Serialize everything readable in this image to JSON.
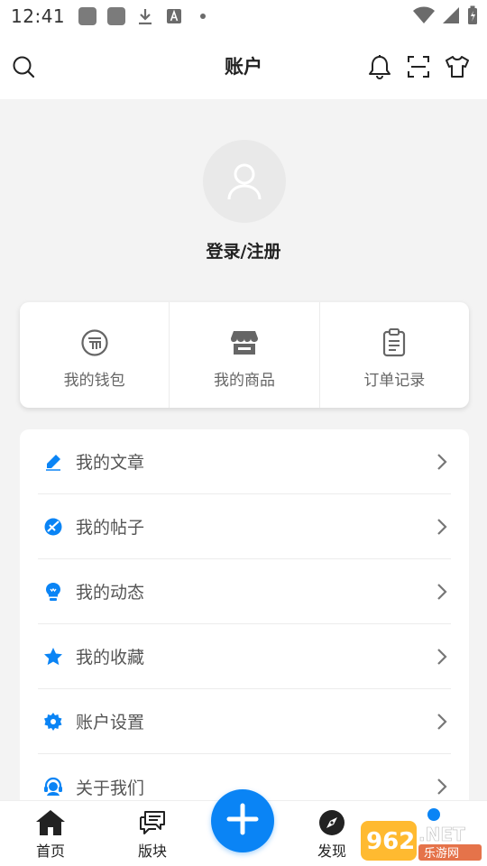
{
  "status_bar": {
    "time": "12:41"
  },
  "header": {
    "title": "账户"
  },
  "profile": {
    "login_text": "登录/注册"
  },
  "shortcuts": [
    {
      "label": "我的钱包",
      "icon": "wallet-coin-icon"
    },
    {
      "label": "我的商品",
      "icon": "store-icon"
    },
    {
      "label": "订单记录",
      "icon": "clipboard-icon"
    }
  ],
  "menu": [
    {
      "label": "我的文章",
      "icon": "pencil-icon"
    },
    {
      "label": "我的帖子",
      "icon": "post-icon"
    },
    {
      "label": "我的动态",
      "icon": "bulb-icon"
    },
    {
      "label": "我的收藏",
      "icon": "star-icon"
    },
    {
      "label": "账户设置",
      "icon": "gear-icon"
    },
    {
      "label": "关于我们",
      "icon": "headset-icon"
    }
  ],
  "bottom_nav": [
    {
      "label": "首页",
      "icon": "home-icon"
    },
    {
      "label": "版块",
      "icon": "chat-icon"
    },
    {
      "label": "发现",
      "icon": "compass-icon"
    }
  ],
  "colors": {
    "accent": "#0a84f5",
    "text_dark": "#222222",
    "text_gray": "#666666"
  }
}
